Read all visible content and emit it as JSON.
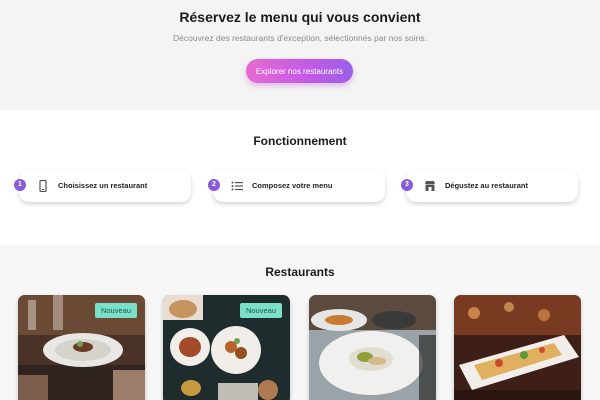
{
  "hero": {
    "title": "Réservez le menu qui vous convient",
    "subtitle": "Découvrez des restaurants d'exception, sélectionnés par nos soins.",
    "cta_label": "Explorer nos restaurants"
  },
  "how": {
    "title": "Fonctionnement",
    "steps": [
      {
        "number": "1",
        "label": "Choisissez un restaurant",
        "icon": "phone-icon"
      },
      {
        "number": "2",
        "label": "Composez votre menu",
        "icon": "list-icon"
      },
      {
        "number": "3",
        "label": "Dégustez au restaurant",
        "icon": "store-icon"
      }
    ]
  },
  "restaurants": {
    "title": "Restaurants",
    "cards": [
      {
        "badge": "Nouveau"
      },
      {
        "badge": "Nouveau"
      },
      {
        "badge": ""
      },
      {
        "badge": ""
      }
    ]
  },
  "colors": {
    "accent_purple": "#8a5bd9",
    "cta_gradient_start": "#e76ad0",
    "cta_gradient_end": "#9b5fe8",
    "badge_bg": "#7ce0c8"
  }
}
